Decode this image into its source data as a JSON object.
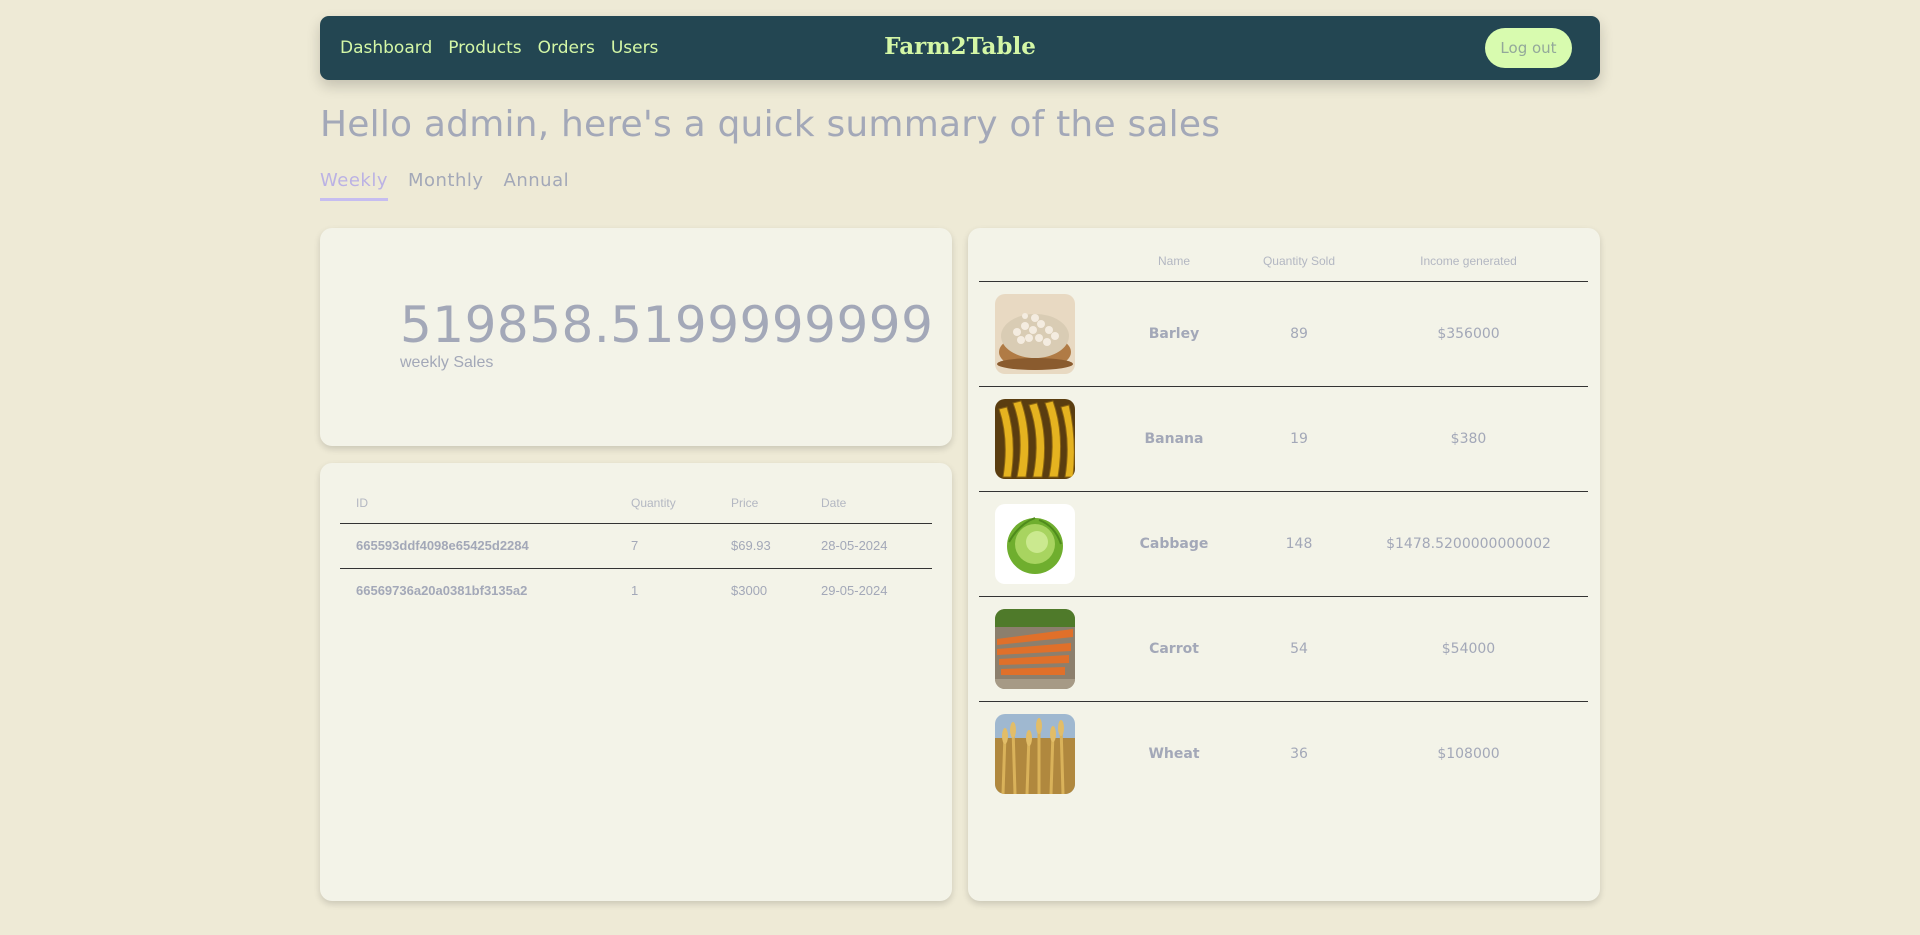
{
  "nav": {
    "links": [
      "Dashboard",
      "Products",
      "Orders",
      "Users"
    ],
    "brand": "Farm2Table",
    "logout": "Log out"
  },
  "greeting": "Hello admin, here's a quick summary of the sales",
  "tabs": [
    "Weekly",
    "Monthly",
    "Annual"
  ],
  "active_tab": "Weekly",
  "sales": {
    "value": "519858.5199999999",
    "label": "weekly Sales"
  },
  "orders": {
    "headers": [
      "ID",
      "Quantity",
      "Price",
      "Date"
    ],
    "rows": [
      {
        "id": "665593ddf4098e65425d2284",
        "quantity": "7",
        "price": "$69.93",
        "date": "28-05-2024"
      },
      {
        "id": "66569736a20a0381bf3135a2",
        "quantity": "1",
        "price": "$3000",
        "date": "29-05-2024"
      }
    ]
  },
  "products": {
    "headers": [
      "",
      "Name",
      "Quantity Sold",
      "Income generated"
    ],
    "rows": [
      {
        "image": "barley-image",
        "name": "Barley",
        "quantity": "89",
        "income": "$356000"
      },
      {
        "image": "banana-image",
        "name": "Banana",
        "quantity": "19",
        "income": "$380"
      },
      {
        "image": "cabbage-image",
        "name": "Cabbage",
        "quantity": "148",
        "income": "$1478.5200000000002"
      },
      {
        "image": "carrot-image",
        "name": "Carrot",
        "quantity": "54",
        "income": "$54000"
      },
      {
        "image": "wheat-image",
        "name": "Wheat",
        "quantity": "36",
        "income": "$108000"
      }
    ]
  },
  "colors": {
    "background": "#eeead6",
    "navbar": "#234652",
    "nav_text": "#d4f7a6",
    "logout_bg": "#d8fbaf",
    "card": "#f3f3e8",
    "active_tab": "#bbb2e4"
  }
}
